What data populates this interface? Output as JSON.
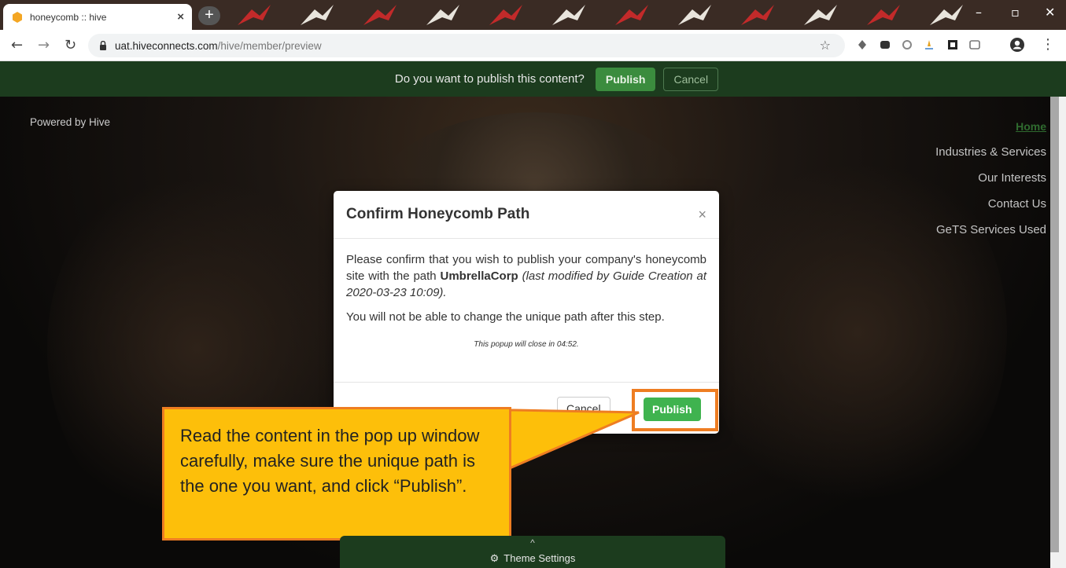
{
  "browser": {
    "tab_title": "honeycomb :: hive",
    "tab_close": "×",
    "new_tab": "+",
    "url_host": "uat.hiveconnects.com",
    "url_path": "/hive/member/preview",
    "icons": [
      "back-arrow-icon",
      "forward-arrow-icon",
      "reload-icon",
      "lock-icon",
      "star-icon",
      "extension-icon",
      "profile-icon",
      "menu-dots-icon"
    ]
  },
  "publish_bar": {
    "question": "Do you want to publish this content?",
    "publish_label": "Publish",
    "cancel_label": "Cancel"
  },
  "site": {
    "powered_by": "Powered by Hive",
    "nav": [
      "Home",
      "Industries & Services",
      "Our Interests",
      "Contact Us",
      "GeTS Services Used"
    ]
  },
  "modal": {
    "title": "Confirm Honeycomb Path",
    "close": "×",
    "body_lead": "Please confirm that you wish to publish your company's honeycomb site with the path ",
    "path_name": "UmbrellaCorp",
    "body_meta": "(last modified by Guide Creation at 2020-03-23 10:09).",
    "warning": "You will not be able to change the unique path after this step.",
    "countdown": "This popup will close in 04:52.",
    "cancel_label": "Cancel",
    "publish_label": "Publish"
  },
  "callout": {
    "text": "Read the content in the pop up window carefully, make sure the unique path is the one you want, and click “Publish”."
  },
  "theme_settings": {
    "label": "Theme Settings",
    "toggle": "^"
  },
  "colors": {
    "banner_green": "#1c3c1e",
    "publish_green": "#3fb34f",
    "callout_yellow": "#fdbf0a",
    "callout_border": "#ee7d22"
  }
}
